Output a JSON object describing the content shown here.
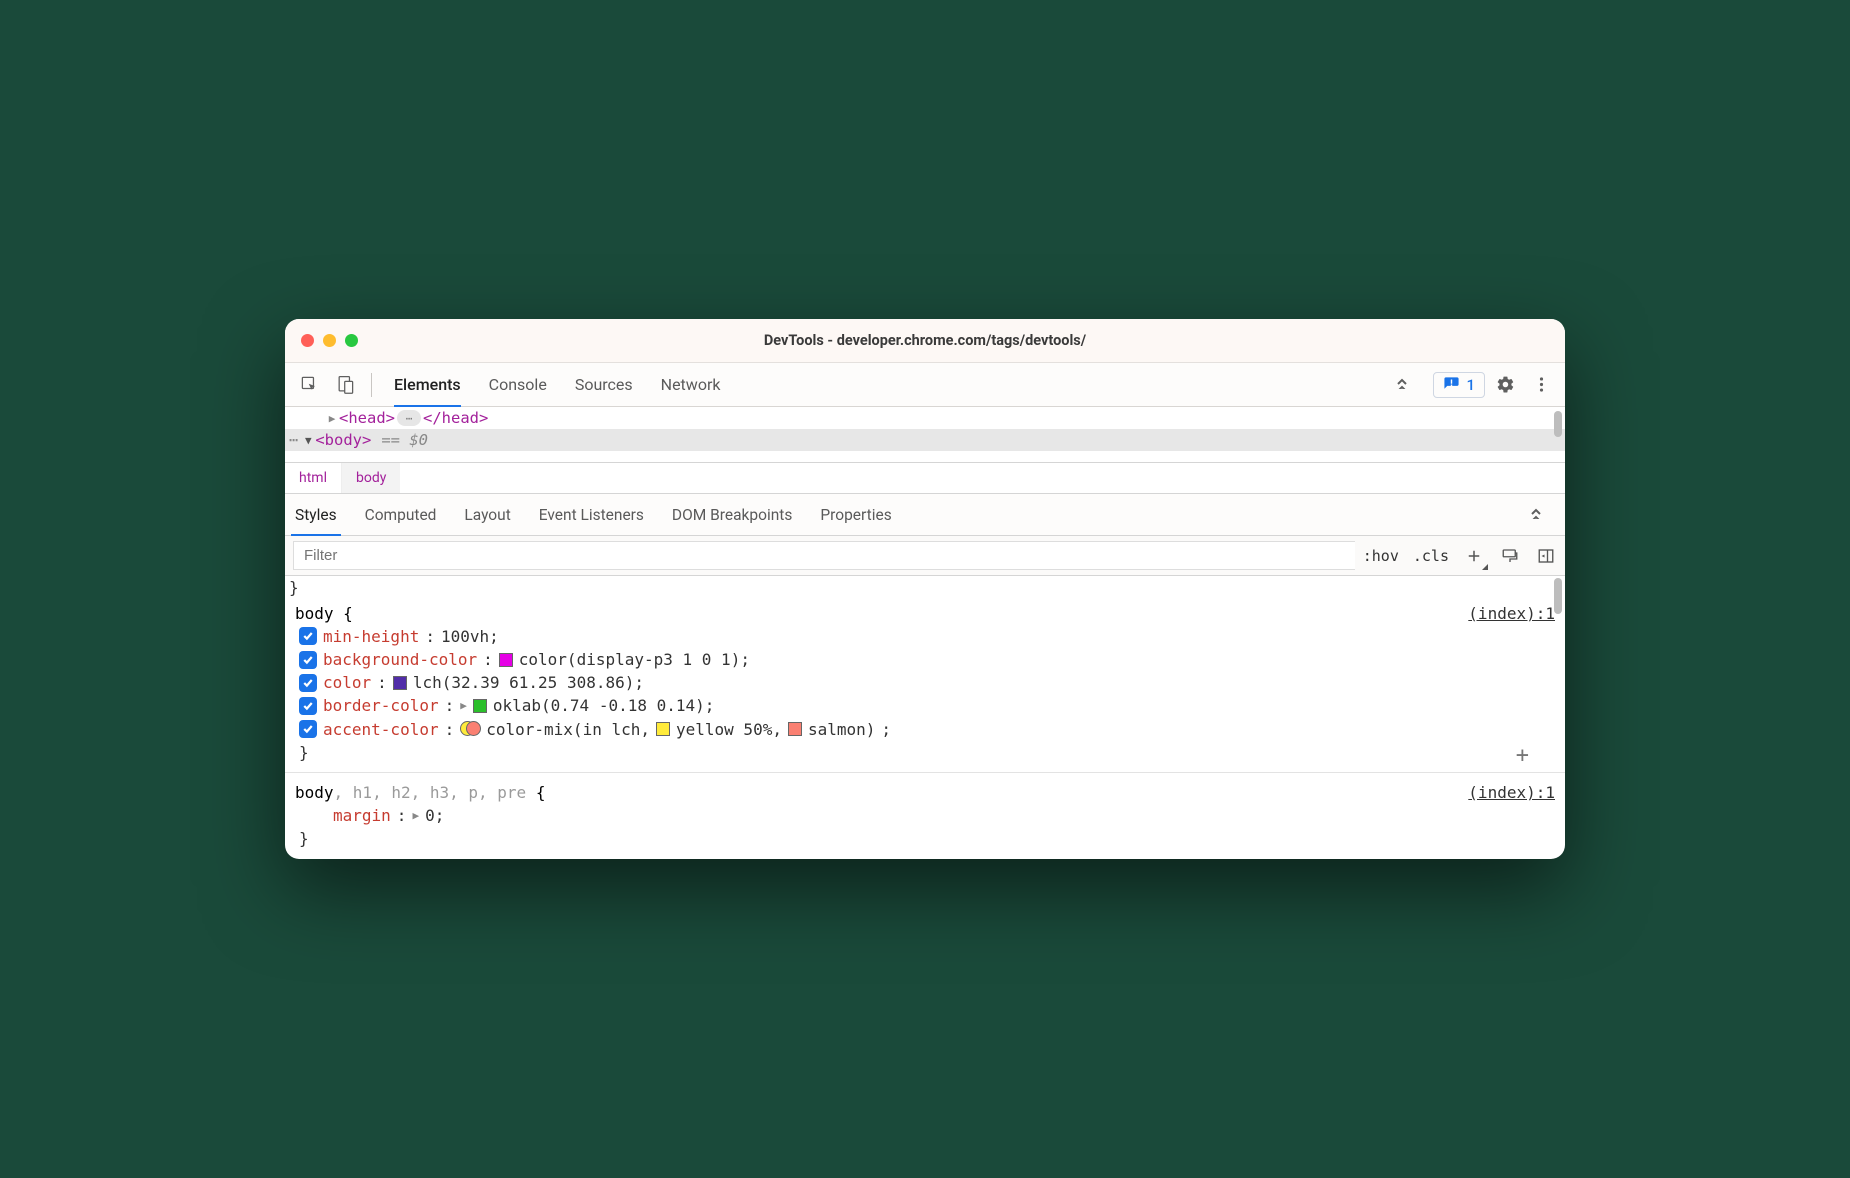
{
  "window": {
    "title": "DevTools - developer.chrome.com/tags/devtools/"
  },
  "toolbar": {
    "panels": [
      "Elements",
      "Console",
      "Sources",
      "Network"
    ],
    "activePanel": "Elements",
    "issuesCount": "1"
  },
  "dom": {
    "head_open": "<head>",
    "head_close": "</head>",
    "body_open": "<body>",
    "selected_suffix": "== $0"
  },
  "breadcrumbs": [
    "html",
    "body"
  ],
  "subpanels": [
    "Styles",
    "Computed",
    "Layout",
    "Event Listeners",
    "DOM Breakpoints",
    "Properties"
  ],
  "activeSubpanel": "Styles",
  "filter": {
    "placeholder": "Filter",
    "hov": ":hov",
    "cls": ".cls"
  },
  "rules": [
    {
      "selector": "body",
      "source": "(index):1",
      "showAdd": true,
      "decls": [
        {
          "checked": true,
          "name": "min-height",
          "value": "100vh",
          "swatches": []
        },
        {
          "checked": true,
          "name": "background-color",
          "value": "color(display-p3 1 0 1)",
          "swatches": [
            {
              "type": "square",
              "color": "#e500e5"
            }
          ]
        },
        {
          "checked": true,
          "name": "color",
          "value": "lch(32.39 61.25 308.86)",
          "swatches": [
            {
              "type": "square",
              "color": "#512da8"
            }
          ]
        },
        {
          "checked": true,
          "name": "border-color",
          "expandable": true,
          "value": "oklab(0.74 -0.18 0.14)",
          "swatches": [
            {
              "type": "square",
              "color": "#2bbf2b"
            }
          ]
        },
        {
          "checked": true,
          "name": "accent-color",
          "value_parts": [
            {
              "text": "color-mix(in lch, "
            },
            {
              "swatch": {
                "type": "square",
                "color": "#ffeb3b"
              }
            },
            {
              "text": "yellow 50%, "
            },
            {
              "swatch": {
                "type": "square",
                "color": "#fa8072"
              }
            },
            {
              "text": "salmon)"
            }
          ],
          "swatches": [
            {
              "type": "stack",
              "a": "#ffeb3b",
              "b": "#fa8072"
            }
          ]
        }
      ]
    },
    {
      "selector_parts": [
        {
          "text": "body",
          "dim": false
        },
        {
          "text": ", h1, h2, h3, p, pre",
          "dim": true
        }
      ],
      "source": "(index):1",
      "decls": [
        {
          "name": "margin",
          "expandable": true,
          "value": "0"
        }
      ]
    }
  ]
}
